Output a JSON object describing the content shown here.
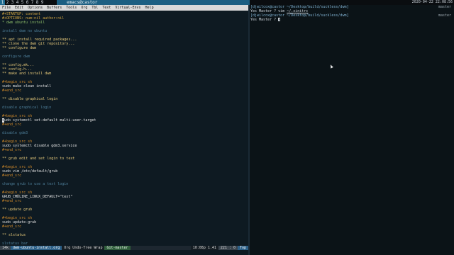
{
  "taskbar": {
    "tags": [
      "1",
      "2",
      "3",
      "4",
      "5",
      "6",
      "7",
      "8",
      "9"
    ],
    "active_tag": "1",
    "window_title": "emacs@castor",
    "clock": "2020-04-22 22:08:56"
  },
  "emacs": {
    "menu": [
      "File",
      "Edit",
      "Options",
      "Buffers",
      "Tools",
      "Org",
      "Tbl",
      "Text",
      "Virtual-Envs",
      "Help"
    ],
    "lines": [
      {
        "t": "#+STARTUP: content",
        "c": "kw"
      },
      {
        "t": "#+OPTIONS: num:nil author:nil",
        "c": "kw"
      },
      {
        "t": "* dwm ubuntu install",
        "c": "h1"
      },
      {
        "t": "",
        "c": "plain"
      },
      {
        "t": "install dwm no ubuntu",
        "c": "comment"
      },
      {
        "t": "",
        "c": "plain"
      },
      {
        "t": "** apt install required packages...",
        "c": "heading"
      },
      {
        "t": "** clone the dwm git repository...",
        "c": "heading"
      },
      {
        "t": "** configure dwm",
        "c": "heading"
      },
      {
        "t": "",
        "c": "plain"
      },
      {
        "t": "configure dwm",
        "c": "comment"
      },
      {
        "t": "",
        "c": "plain"
      },
      {
        "t": "** config.mk...",
        "c": "heading"
      },
      {
        "t": "** config.h...",
        "c": "heading"
      },
      {
        "t": "** make and install dwm",
        "c": "heading"
      },
      {
        "t": "",
        "c": "plain"
      },
      {
        "t": "#+begin_src sh",
        "c": "src"
      },
      {
        "t": "sudo make clean install",
        "c": "code"
      },
      {
        "t": "#+end_src",
        "c": "src"
      },
      {
        "t": "",
        "c": "plain"
      },
      {
        "t": "** disable graphical login",
        "c": "heading"
      },
      {
        "t": "",
        "c": "plain"
      },
      {
        "t": "disable graphical login",
        "c": "comment"
      },
      {
        "t": "",
        "c": "plain"
      },
      {
        "t": "#+begin_src sh",
        "c": "src"
      },
      {
        "t": "sudo systemctl set-default multi-user.target",
        "c": "code",
        "cursor": true
      },
      {
        "t": "#+end_src",
        "c": "src"
      },
      {
        "t": "",
        "c": "plain"
      },
      {
        "t": "disable gdm3",
        "c": "comment"
      },
      {
        "t": "",
        "c": "plain"
      },
      {
        "t": "#+begin_src sh",
        "c": "src"
      },
      {
        "t": "sudo systemctl disable gdm3.service",
        "c": "code"
      },
      {
        "t": "#+end_src",
        "c": "src"
      },
      {
        "t": "",
        "c": "plain"
      },
      {
        "t": "** grub edit and set login to text",
        "c": "heading"
      },
      {
        "t": "",
        "c": "plain"
      },
      {
        "t": "#+begin_src sh",
        "c": "src"
      },
      {
        "t": "sudo vim /etc/default/grub",
        "c": "code"
      },
      {
        "t": "#+end_src",
        "c": "src"
      },
      {
        "t": "",
        "c": "plain"
      },
      {
        "t": "change grub to use a text login",
        "c": "comment"
      },
      {
        "t": "",
        "c": "plain"
      },
      {
        "t": "#+begin_src sh",
        "c": "src"
      },
      {
        "t": "GRUB_CMDLINE_LINUX_DEFAULT=\"text\"",
        "c": "code"
      },
      {
        "t": "#+end_src",
        "c": "src"
      },
      {
        "t": "",
        "c": "plain"
      },
      {
        "t": "** update grub",
        "c": "heading"
      },
      {
        "t": "",
        "c": "plain"
      },
      {
        "t": "#+begin_src sh",
        "c": "src"
      },
      {
        "t": "sudo update-grub",
        "c": "code"
      },
      {
        "t": "#+end_src",
        "c": "src"
      },
      {
        "t": "",
        "c": "plain"
      },
      {
        "t": "** slstatus",
        "c": "heading"
      },
      {
        "t": "",
        "c": "plain"
      },
      {
        "t": "slstatus bar",
        "c": "comment"
      }
    ],
    "modeline": {
      "size": "14k",
      "buffer": "dwm-ubuntu-install.org",
      "modes": "Org Undo-Tree Wrap",
      "vc": "Git-master",
      "time": "10:08p 1.41",
      "line": "221 : 0",
      "position": "Top"
    }
  },
  "terminal": {
    "lines": [
      {
        "prompt": "[djwilcox@castor ~/Desktop/build/suckless/dwm]",
        "right": "master"
      },
      {
        "text": "Yes Master ? vim ",
        "arg": "~/.xinitrc"
      },
      {
        "prompt": "[djwilcox@castor ~/Desktop/build/suckless/dwm]",
        "right": "master"
      },
      {
        "text": "Yes Master ? ",
        "cursor": true
      }
    ]
  }
}
